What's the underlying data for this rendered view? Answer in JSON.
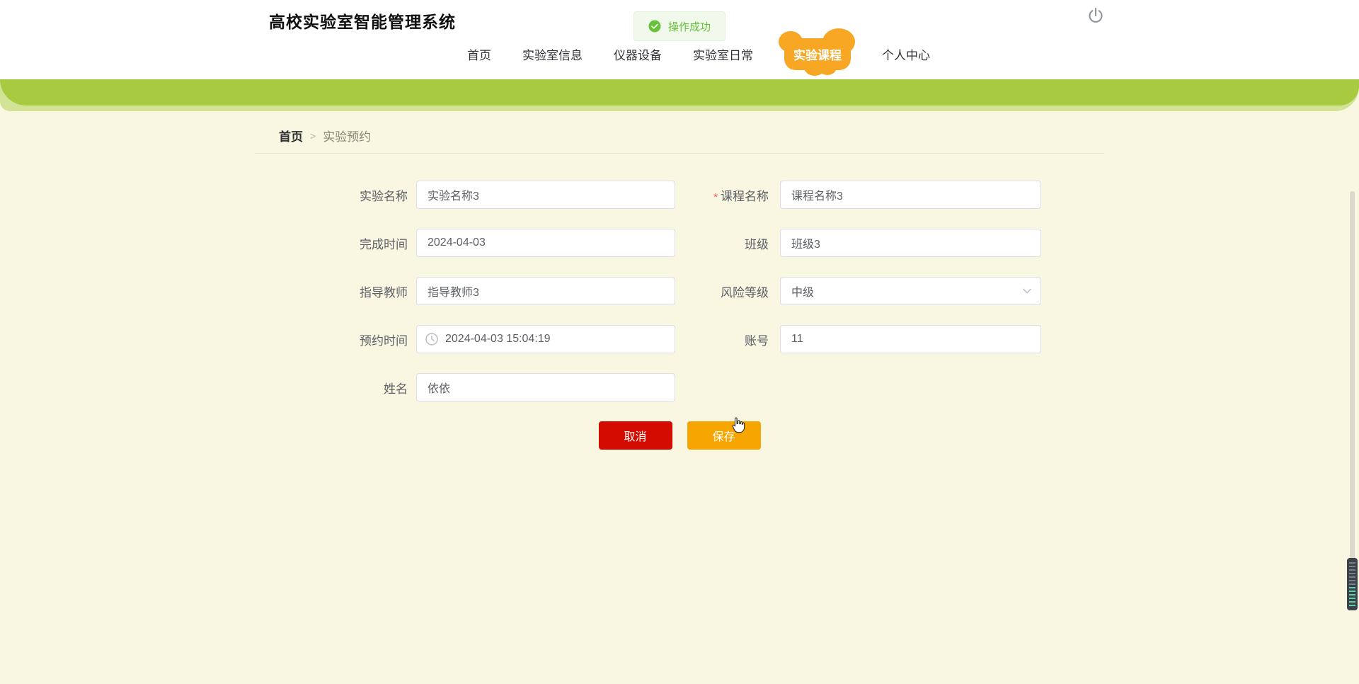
{
  "header": {
    "title": "高校实验室智能管理系统",
    "nav": [
      {
        "label": "首页",
        "active": false
      },
      {
        "label": "实验室信息",
        "active": false
      },
      {
        "label": "仪器设备",
        "active": false
      },
      {
        "label": "实验室日常",
        "active": false
      },
      {
        "label": "实验课程",
        "active": true
      },
      {
        "label": "个人中心",
        "active": false
      }
    ]
  },
  "toast": {
    "text": "操作成功"
  },
  "breadcrumb": {
    "home": "首页",
    "separator": ">",
    "current": "实验预约"
  },
  "form": {
    "required_mark": "*",
    "fields": [
      {
        "id": "experiment-name",
        "label": "实验名称",
        "value": "实验名称3"
      },
      {
        "id": "course-name",
        "label": "课程名称",
        "value": "课程名称3",
        "required": true
      },
      {
        "id": "finish-time",
        "label": "完成时间",
        "value": "2024-04-03"
      },
      {
        "id": "class",
        "label": "班级",
        "value": "班级3"
      },
      {
        "id": "advisor",
        "label": "指导教师",
        "value": "指导教师3"
      },
      {
        "id": "risk-level",
        "label": "风险等级",
        "value": "中级",
        "type": "select"
      },
      {
        "id": "reserve-time",
        "label": "预约时间",
        "value": "2024-04-03 15:04:19",
        "icon": "clock"
      },
      {
        "id": "account",
        "label": "账号",
        "value": "11"
      },
      {
        "id": "name",
        "label": "姓名",
        "value": "依依"
      }
    ],
    "buttons": {
      "cancel": "取消",
      "save": "保存"
    }
  },
  "colors": {
    "accent_orange": "#f7a724",
    "banner_green_dark": "#a7ca41",
    "banner_green_light": "#d2e395",
    "success_green": "#67c23a",
    "cancel_red": "#d40b00",
    "save_orange": "#f7a500",
    "page_bg": "#f9f6e1"
  }
}
